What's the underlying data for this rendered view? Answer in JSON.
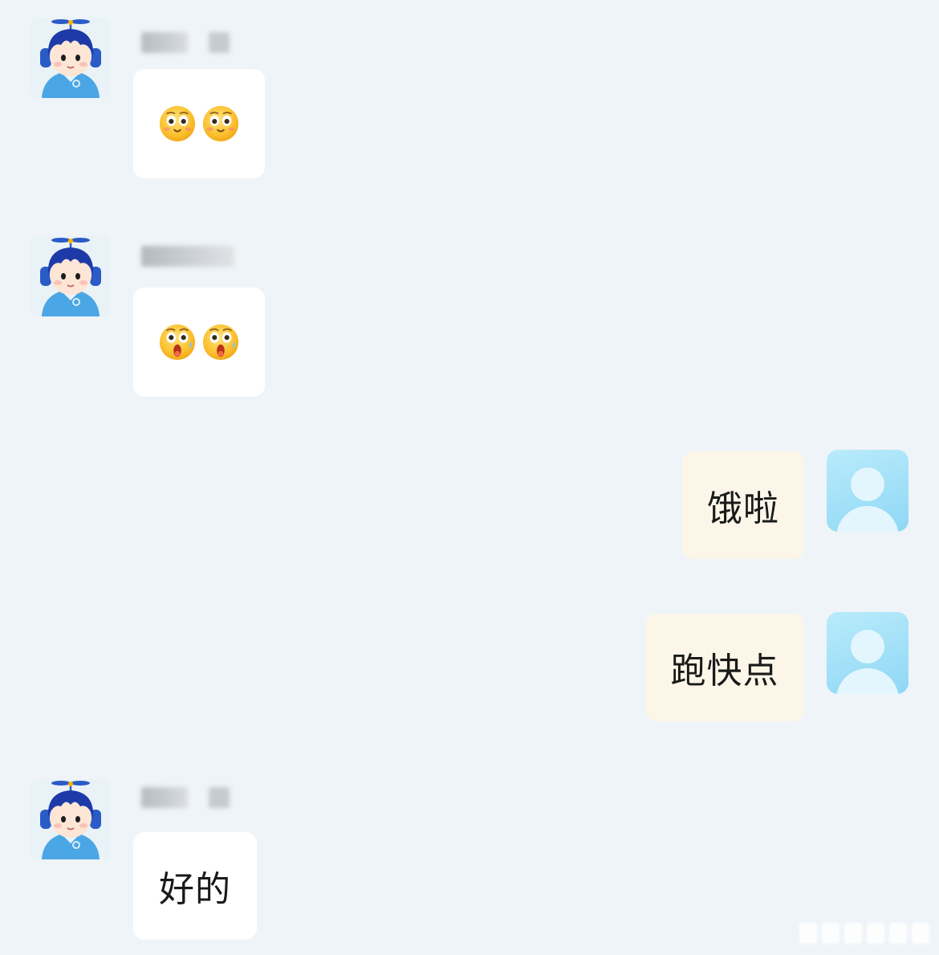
{
  "messages": [
    {
      "side": "incoming",
      "avatar": "bot-avatar-icon",
      "content_type": "emoji",
      "emoji": [
        "smiling-eyes-icon",
        "smiling-eyes-icon"
      ]
    },
    {
      "side": "incoming",
      "avatar": "bot-avatar-icon",
      "content_type": "emoji",
      "emoji": [
        "surprised-icon",
        "surprised-icon"
      ]
    },
    {
      "side": "outgoing",
      "avatar": "default-user-avatar-icon",
      "content_type": "text",
      "text": "饿啦"
    },
    {
      "side": "outgoing",
      "avatar": "default-user-avatar-icon",
      "content_type": "text",
      "text": "跑快点"
    },
    {
      "side": "incoming",
      "avatar": "bot-avatar-icon",
      "content_type": "text",
      "text": "好的"
    }
  ],
  "colors": {
    "background": "#eff4f8",
    "incoming_bubble": "#ffffff",
    "outgoing_bubble": "#fcf6e8",
    "bot_hair": "#1f3fae",
    "bot_body": "#4fa7e6",
    "user_avatar": "#9fdcf6"
  }
}
